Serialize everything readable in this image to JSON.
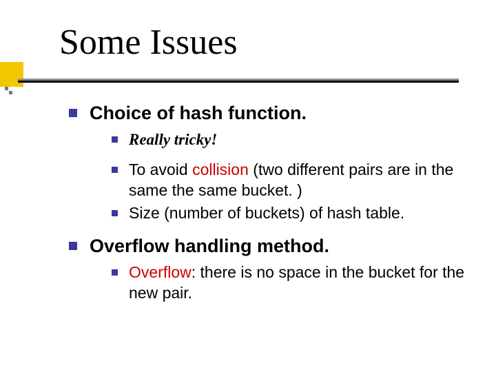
{
  "title": "Some Issues",
  "items": [
    {
      "text": "Choice of hash function.",
      "sub": [
        {
          "kind": "tricky",
          "text": "Really tricky!"
        },
        {
          "kind": "collision",
          "pre": "To avoid ",
          "word": "collision",
          "post": " (two different pairs are in the same the same bucket. )"
        },
        {
          "kind": "plain",
          "text": "Size (number of buckets) of hash table."
        }
      ]
    },
    {
      "text": "Overflow handling method.",
      "sub": [
        {
          "kind": "overflow",
          "word": "Overflow",
          "post": ": there is no space in the bucket for the new pair."
        }
      ]
    }
  ]
}
